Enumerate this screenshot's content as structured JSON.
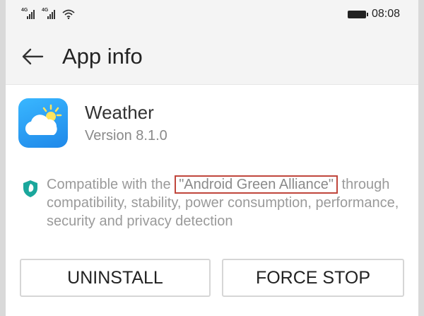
{
  "status_bar": {
    "time": "08:08",
    "signal1_label": "4G",
    "signal2_label": "4G"
  },
  "app_bar": {
    "title": "App info"
  },
  "app": {
    "name": "Weather",
    "version": "Version 8.1.0"
  },
  "compatibility": {
    "prefix": "Compatible with the ",
    "highlight": "\"Android Green Alliance\"",
    "suffix": " through compatibility, stability, power consumption, performance, security and privacy detection"
  },
  "buttons": {
    "uninstall": "UNINSTALL",
    "force_stop": "FORCE STOP"
  },
  "colors": {
    "shield": "#1aa79c",
    "highlight_border": "#c0463c",
    "icon_top": "#39b7ff",
    "icon_bottom": "#1f88e9"
  }
}
